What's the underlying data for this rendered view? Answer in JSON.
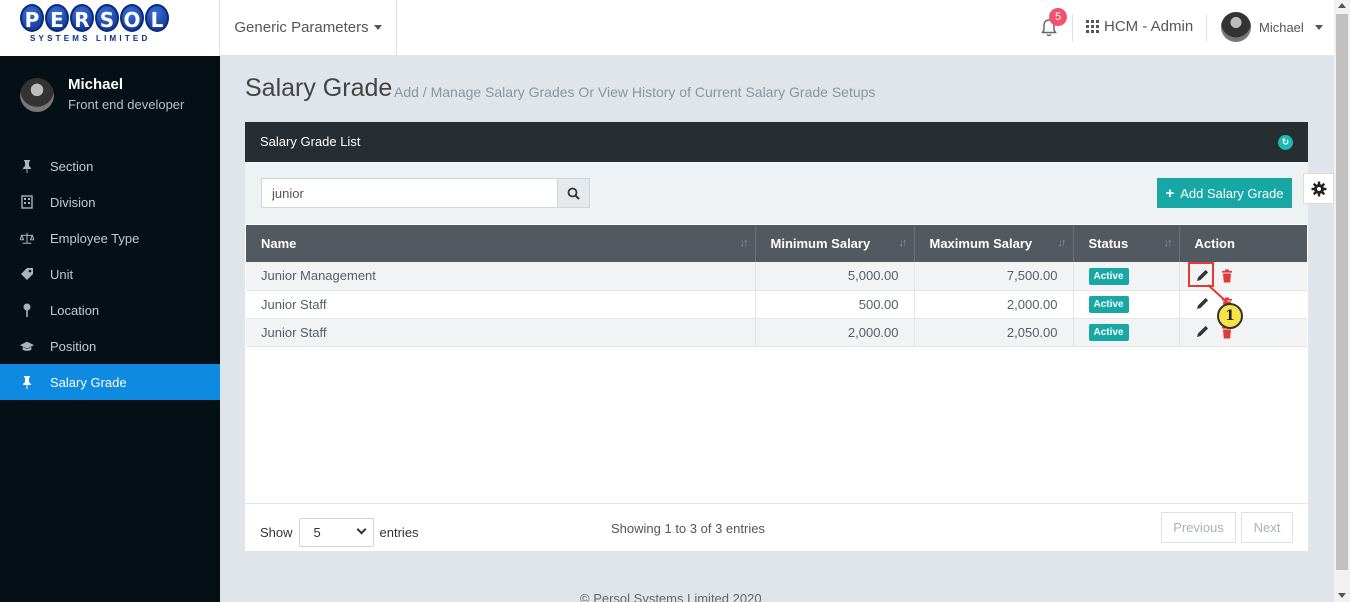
{
  "logo": {
    "letters": [
      "P",
      "E",
      "R",
      "S",
      "O",
      "L"
    ],
    "subtitle": "SYSTEMS LIMITED"
  },
  "header": {
    "module_dropdown": "Generic Parameters",
    "notifications_count": "5",
    "app_name": "HCM - Admin",
    "user_name": "Michael"
  },
  "sidebar": {
    "profile": {
      "name": "Michael",
      "role": "Front end developer"
    },
    "items": [
      {
        "label": "Section",
        "icon": "pin-icon",
        "active": false
      },
      {
        "label": "Division",
        "icon": "building-icon",
        "active": false
      },
      {
        "label": "Employee Type",
        "icon": "scale-icon",
        "active": false
      },
      {
        "label": "Unit",
        "icon": "tag-icon",
        "active": false
      },
      {
        "label": "Location",
        "icon": "map-pin-icon",
        "active": false
      },
      {
        "label": "Position",
        "icon": "graduation-cap-icon",
        "active": false
      },
      {
        "label": "Salary Grade",
        "icon": "pin-icon",
        "active": true
      }
    ]
  },
  "page": {
    "title": "Salary Grade",
    "subtitle": "Add / Manage Salary Grades Or View History of Current Salary Grade Setups"
  },
  "card": {
    "title": "Salary Grade List",
    "search_value": "junior",
    "add_button": "Add Salary Grade"
  },
  "table": {
    "columns": [
      "Name",
      "Minimum Salary",
      "Maximum Salary",
      "Status",
      "Action"
    ],
    "rows": [
      {
        "name": "Junior Management",
        "min": "5,000.00",
        "max": "7,500.00",
        "status": "Active"
      },
      {
        "name": "Junior Staff",
        "min": "500.00",
        "max": "2,000.00",
        "status": "Active"
      },
      {
        "name": "Junior Staff",
        "min": "2,000.00",
        "max": "2,050.00",
        "status": "Active"
      }
    ]
  },
  "footer": {
    "show_label": "Show",
    "entries_value": "5",
    "entries_label": "entries",
    "info": "Showing 1 to 3 of 3 entries",
    "previous": "Previous",
    "next": "Next",
    "copyright": "© Persol Systems Limited 2020"
  },
  "callout": {
    "number": "1"
  },
  "colors": {
    "accent": "#17a8a5",
    "active_nav": "#0e8ae0",
    "sidebar_bg": "#041016",
    "highlight": "#e53935"
  }
}
